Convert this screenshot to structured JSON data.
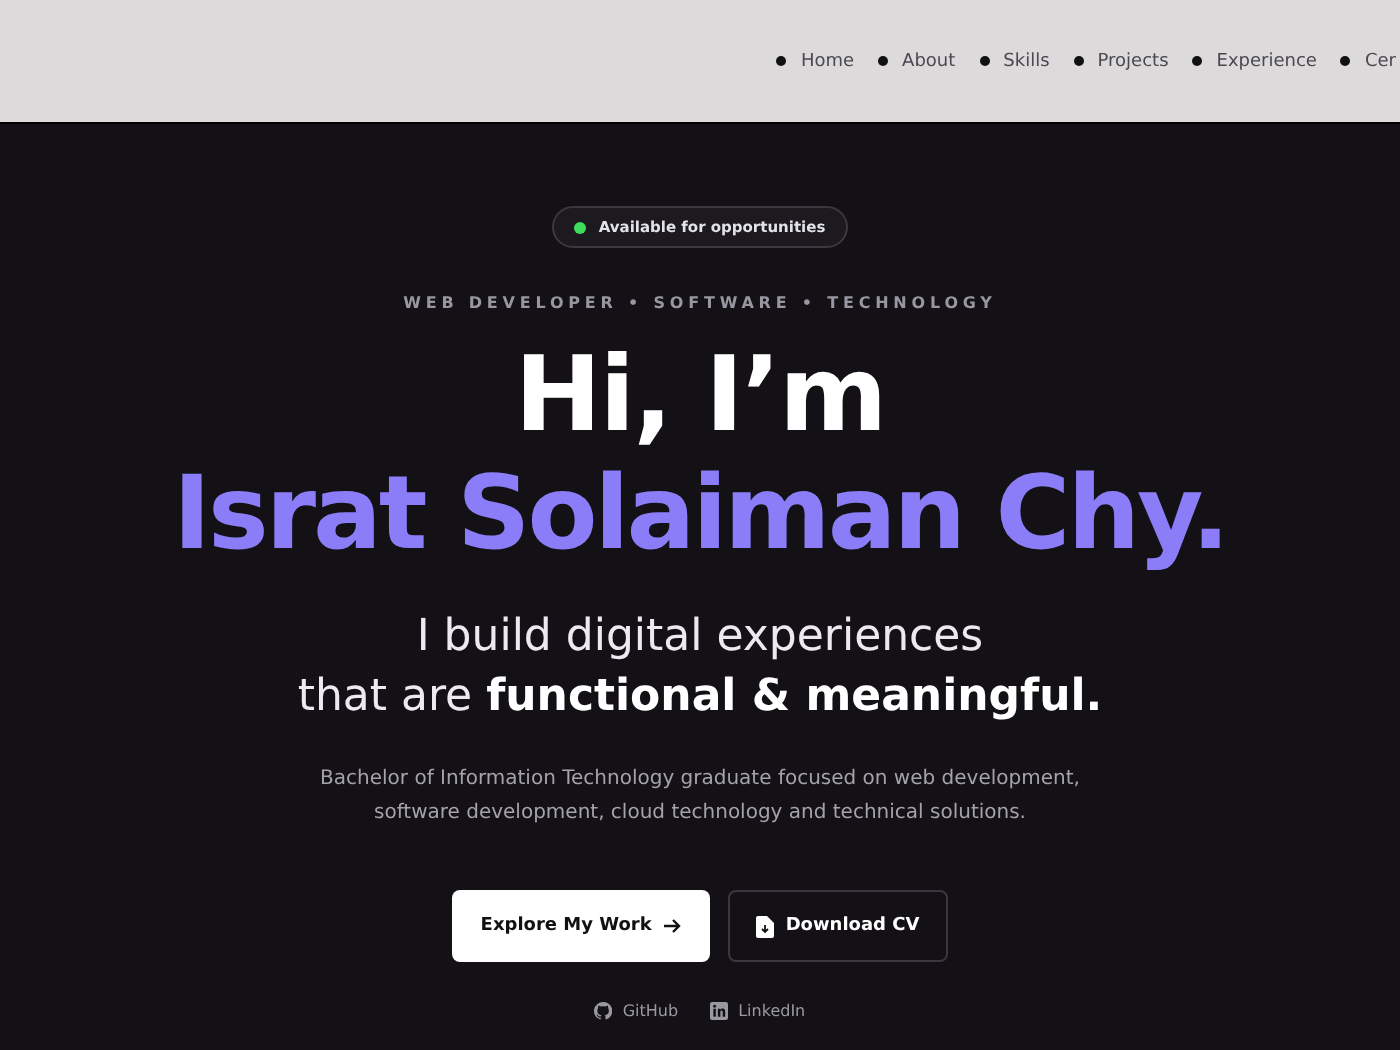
{
  "nav": {
    "items": [
      "Home",
      "About",
      "Skills",
      "Projects",
      "Experience",
      "Cer"
    ]
  },
  "hero": {
    "status_badge": {
      "label": "Available for opportunities",
      "color": "#3ddc5a"
    },
    "eyebrow": "WEB DEVELOPER • SOFTWARE • TECHNOLOGY",
    "greeting": "Hi, I’m",
    "name": "Israt Solaiman Chy.",
    "tagline_lines": [
      "I build digital experiences",
      "that are **functional & meaningful.**"
    ],
    "description": "Bachelor of Information Technology graduate focused on web development, software development, cloud technology and technical solutions.",
    "buttons": [
      {
        "label": "Explore My Work",
        "kind": "primary"
      },
      {
        "label": "Download CV",
        "kind": "secondary"
      }
    ],
    "social_links": [
      {
        "label": "GitHub",
        "kind": "github"
      },
      {
        "label": "LinkedIn",
        "kind": "linkedin"
      }
    ]
  }
}
